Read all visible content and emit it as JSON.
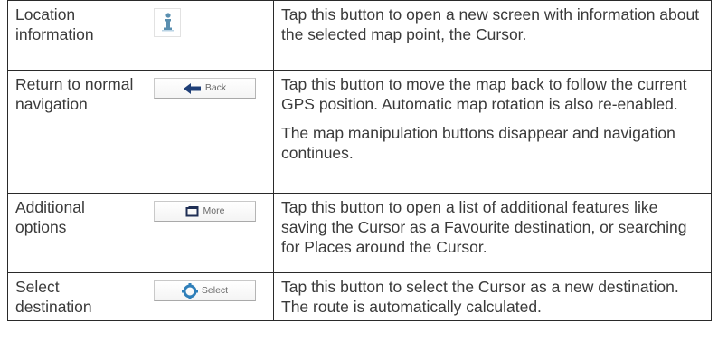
{
  "rows": [
    {
      "function": "Location information",
      "button_icon": "info-person-icon",
      "button_label": "",
      "description": [
        "Tap this button to open a new screen with information about the selected map point, the Cursor."
      ]
    },
    {
      "function": "Return to normal navigation",
      "button_icon": "back-arrow-icon",
      "button_label": "Back",
      "description": [
        "Tap this button to move the map back to follow the current GPS position. Automatic map rotation is also re-enabled.",
        "The map manipulation buttons disappear and navigation continues."
      ]
    },
    {
      "function": "Additional options",
      "button_icon": "more-window-icon",
      "button_label": "More",
      "description": [
        "Tap this button to open a list of additional features like saving the Cursor as a Favourite destination, or searching for Places around the Cursor."
      ]
    },
    {
      "function": "Select destination",
      "button_icon": "select-target-icon",
      "button_label": "Select",
      "description": [
        "Tap this button to select the Cursor as a new destination. The route is automatically calculated."
      ]
    }
  ],
  "colors": {
    "text": "#3a3a3a",
    "border": "#2a2a2a",
    "select_icon": "#2f7fb9",
    "arrow_icon": "#1f3f78"
  }
}
